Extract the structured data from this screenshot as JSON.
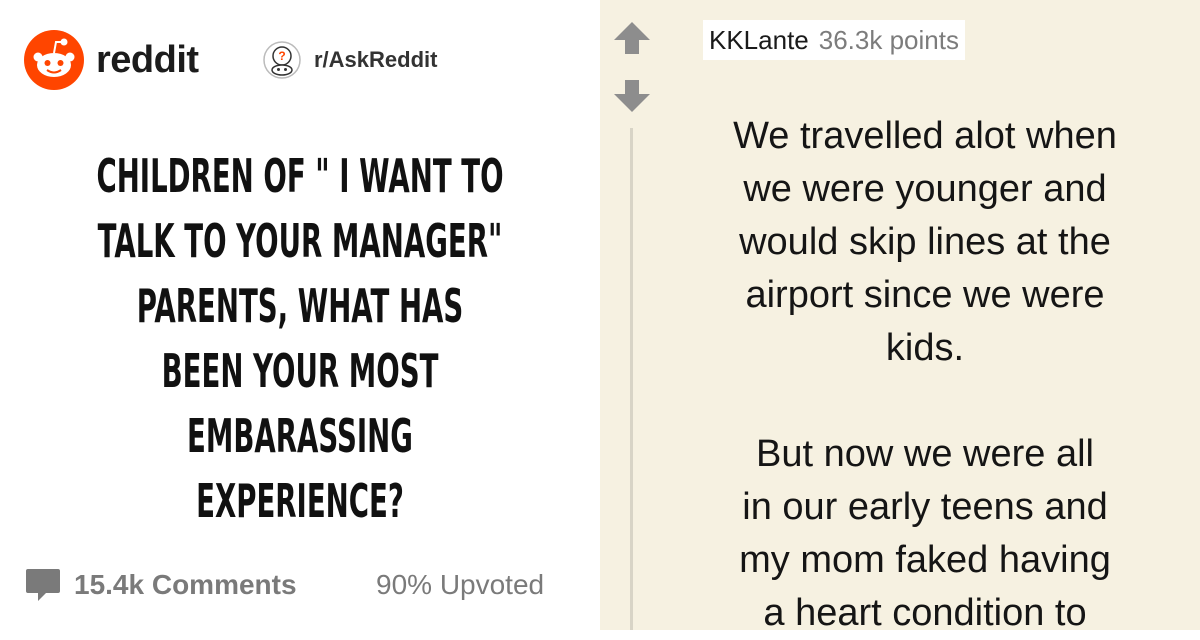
{
  "brand": {
    "name": "reddit",
    "accent_color": "#FF4500"
  },
  "subreddit": {
    "name": "r/AskReddit",
    "icon": "askreddit-snoo-icon"
  },
  "post": {
    "title_lines": [
      "CHILDREN OF \" I WANT TO",
      "TALK TO YOUR MANAGER\"",
      "PARENTS, WHAT HAS",
      "BEEN YOUR MOST",
      "EMBARASSING",
      "EXPERIENCE?"
    ],
    "comments_count": "15.4k Comments",
    "upvoted": "90% Upvoted"
  },
  "comment": {
    "author": "KKLante",
    "points": "36.3k points",
    "paragraph1": [
      "We travelled alot when",
      "we were younger and",
      "would skip lines at the",
      "airport since we were",
      "kids."
    ],
    "paragraph2": [
      "But now we were all",
      "in our early teens and",
      "my mom faked having",
      "a heart condition to"
    ]
  }
}
